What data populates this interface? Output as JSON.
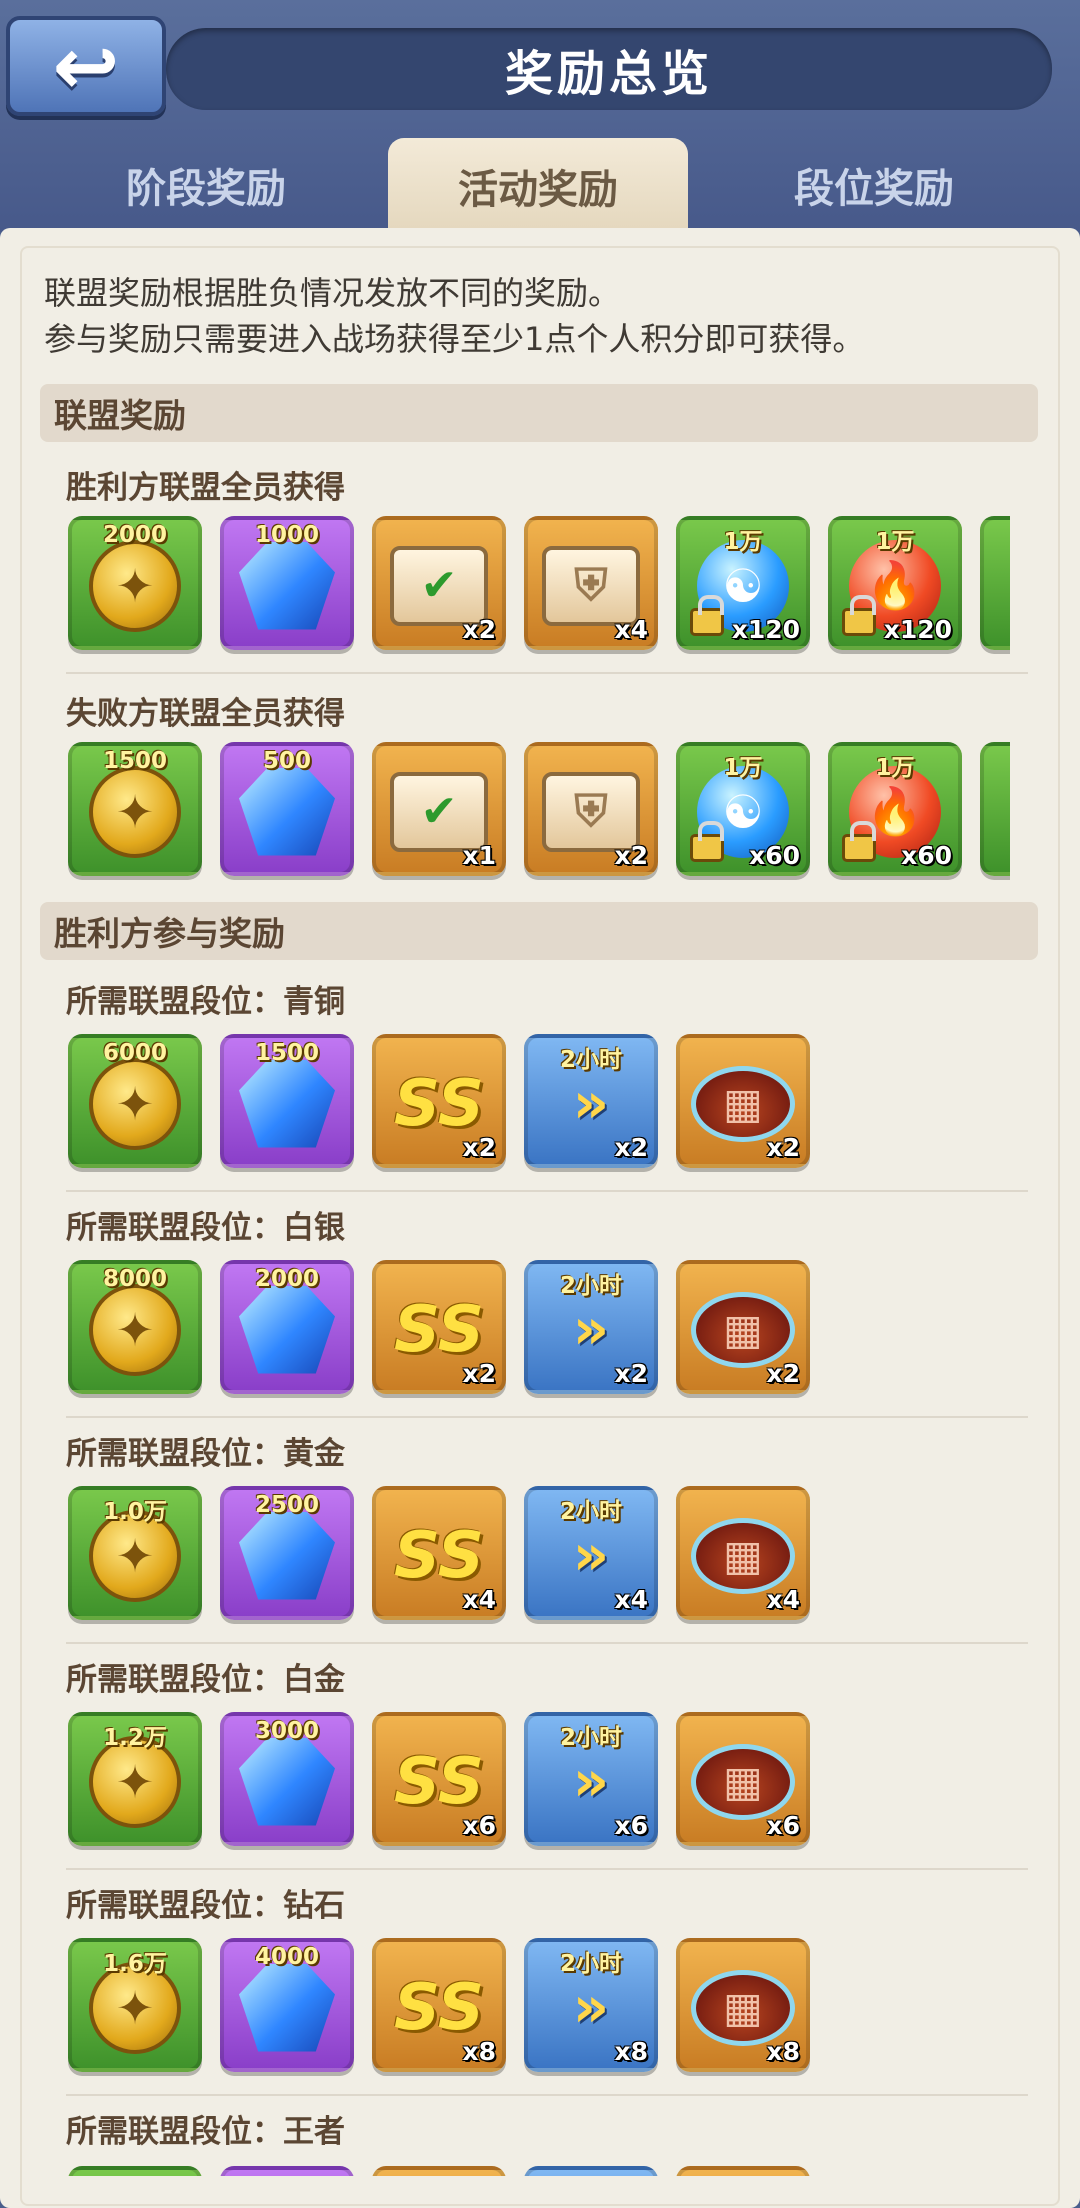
{
  "header": {
    "title": "奖励总览"
  },
  "tabs": [
    {
      "label": "阶段奖励",
      "active": false
    },
    {
      "label": "活动奖励",
      "active": true
    },
    {
      "label": "段位奖励",
      "active": false
    }
  ],
  "intro": {
    "line1": "联盟奖励根据胜负情况发放不同的奖励。",
    "line2": "参与奖励只需要进入战场获得至少1点个人积分即可获得。"
  },
  "alliance_section": {
    "title": "联盟奖励",
    "winners": {
      "label": "胜利方联盟全员获得",
      "items": [
        {
          "icon": "gold-coin-icon",
          "top": "2000",
          "qty": ""
        },
        {
          "icon": "crystal-icon",
          "top": "1000",
          "qty": ""
        },
        {
          "icon": "quest-scroll-icon",
          "top": "",
          "qty": "x2"
        },
        {
          "icon": "helmet-scroll-icon",
          "top": "",
          "qty": "x4"
        },
        {
          "icon": "water-orb-icon",
          "top": "1万",
          "qty": "x120"
        },
        {
          "icon": "fire-orb-icon",
          "top": "1万",
          "qty": "x120"
        }
      ]
    },
    "losers": {
      "label": "失败方联盟全员获得",
      "items": [
        {
          "icon": "gold-coin-icon",
          "top": "1500",
          "qty": ""
        },
        {
          "icon": "crystal-icon",
          "top": "500",
          "qty": ""
        },
        {
          "icon": "quest-scroll-icon",
          "top": "",
          "qty": "x1"
        },
        {
          "icon": "helmet-scroll-icon",
          "top": "",
          "qty": "x2"
        },
        {
          "icon": "water-orb-icon",
          "top": "1万",
          "qty": "x60"
        },
        {
          "icon": "fire-orb-icon",
          "top": "1万",
          "qty": "x60"
        }
      ]
    }
  },
  "participation_section": {
    "title": "胜利方参与奖励",
    "tiers": [
      {
        "label": "所需联盟段位：青铜",
        "coin": "6000",
        "crystal": "1500",
        "ss_qty": "x2",
        "tower_top": "2小时",
        "tower_qty": "x2",
        "meat_qty": "x2"
      },
      {
        "label": "所需联盟段位：白银",
        "coin": "8000",
        "crystal": "2000",
        "ss_qty": "x2",
        "tower_top": "2小时",
        "tower_qty": "x2",
        "meat_qty": "x2"
      },
      {
        "label": "所需联盟段位：黄金",
        "coin": "1.0万",
        "crystal": "2500",
        "ss_qty": "x4",
        "tower_top": "2小时",
        "tower_qty": "x4",
        "meat_qty": "x4"
      },
      {
        "label": "所需联盟段位：白金",
        "coin": "1.2万",
        "crystal": "3000",
        "ss_qty": "x6",
        "tower_top": "2小时",
        "tower_qty": "x6",
        "meat_qty": "x6"
      },
      {
        "label": "所需联盟段位：钻石",
        "coin": "1.6万",
        "crystal": "4000",
        "ss_qty": "x8",
        "tower_top": "2小时",
        "tower_qty": "x8",
        "meat_qty": "x8"
      },
      {
        "label": "所需联盟段位：王者"
      }
    ]
  },
  "glyphs": {
    "back": "↩",
    "coin": "✦",
    "check": "✔",
    "helm": "⛨",
    "water": "☯",
    "fire": "🔥",
    "ss": "SS",
    "tower": "»",
    "meat": "▦"
  }
}
